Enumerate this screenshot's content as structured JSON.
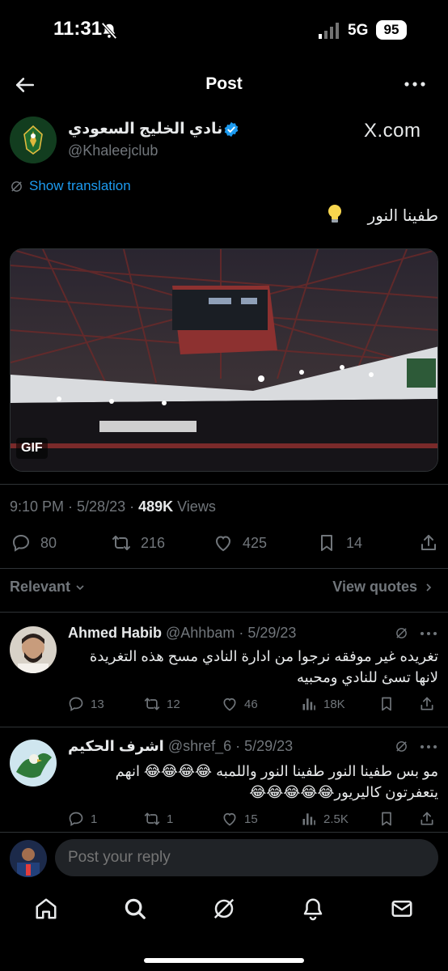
{
  "status": {
    "time": "11:31",
    "network": "5G",
    "battery": "95"
  },
  "header": {
    "title": "Post"
  },
  "post": {
    "display_name": "نادي الخليج السعودي",
    "handle": "@Khaleejclub",
    "watermark": "X.com",
    "show_translation": "Show translation",
    "text": "طفينا النور",
    "gif_label": "GIF",
    "time": "9:10 PM · 5/28/23 · ",
    "views_count": "489K",
    "views_label": " Views",
    "replies": "80",
    "reposts": "216",
    "likes": "425",
    "bookmarks": "14"
  },
  "sort": {
    "label": "Relevant",
    "view_quotes": "View quotes"
  },
  "replies": [
    {
      "name": "Ahmed Habib",
      "meta": " @Ahhbam · 5/29/23",
      "text": "تغريده غير موفقه نرجوا من ادارة النادي مسح هذه التغريدة لانها تسئ للنادي ومحبيه",
      "replies": "13",
      "reposts": "12",
      "likes": "46",
      "views": "18K"
    },
    {
      "name": "اشرف الحكيم",
      "meta": " @shref_6 · 5/29/23",
      "text": "مو بس طفينا النور طفينا النور واللمبه 😂😂😂😂 انهم يتعفرتون كاليريور😂😂😂😂😂",
      "replies": "1",
      "reposts": "1",
      "likes": "15",
      "views": "2.5K"
    }
  ],
  "composer": {
    "placeholder": "Post your reply"
  },
  "icons": {
    "accent": "#1d9bf0",
    "muted": "#71767b"
  }
}
